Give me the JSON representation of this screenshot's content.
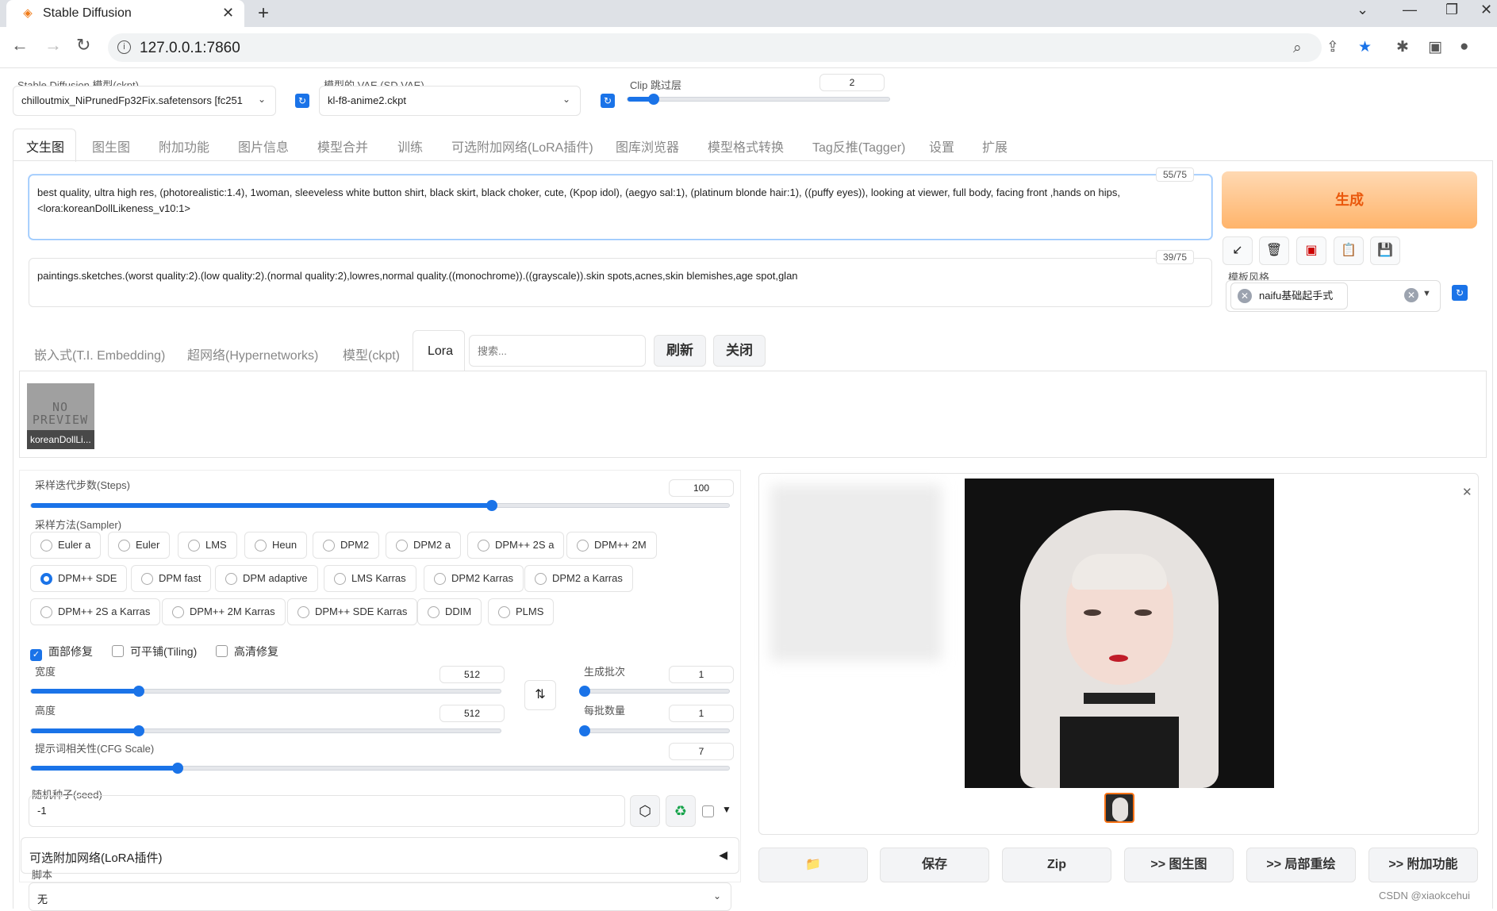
{
  "browser": {
    "tab_title": "Stable Diffusion",
    "url": "127.0.0.1:7860"
  },
  "models": {
    "ckpt_label": "Stable Diffusion 模型(ckpt)",
    "ckpt_value": "chilloutmix_NiPrunedFp32Fix.safetensors [fc251",
    "vae_label": "模型的 VAE (SD VAE)",
    "vae_value": "kl-f8-anime2.ckpt",
    "clip_label": "Clip 跳过层",
    "clip_value": "2",
    "clip_level": 0.1
  },
  "main_tabs": [
    "文生图",
    "图生图",
    "附加功能",
    "图片信息",
    "模型合并",
    "训练",
    "可选附加网络(LoRA插件)",
    "图库浏览器",
    "模型格式转换",
    "Tag反推(Tagger)",
    "设置",
    "扩展"
  ],
  "prompt": {
    "text": "best quality, ultra high res, (photorealistic:1.4), 1woman, sleeveless white button shirt, black skirt, black choker, cute, (Kpop idol), (aegyo sal:1), (platinum blonde hair:1), ((puffy eyes)), looking at viewer, full body, facing front ,hands on hips, <lora:koreanDollLikeness_v10:1>",
    "counter": "55/75"
  },
  "negative": {
    "text": "paintings.sketches.(worst quality:2).(low quality:2).(normal quality:2),lowres,normal quality.((monochrome)).((grayscale)).skin spots,acnes,skin blemishes,age spot,glan",
    "counter": "39/75"
  },
  "generate_label": "生成",
  "action_icons": [
    "arrow-icon",
    "trash-icon",
    "red-card-icon",
    "clipboard-icon",
    "save-icon"
  ],
  "style": {
    "label": "模板风格",
    "chip": "naifu基础起手式"
  },
  "extra_tabs": [
    "嵌入式(T.I. Embedding)",
    "超网络(Hypernetworks)",
    "模型(ckpt)",
    "Lora"
  ],
  "extra_search_placeholder": "搜索...",
  "extra_refresh": "刷新",
  "extra_close": "关闭",
  "lora_card": {
    "preview_text": "NO PREVIEW",
    "name": "koreanDollLi..."
  },
  "steps": {
    "label": "采样迭代步数(Steps)",
    "value": "100",
    "level": 0.66
  },
  "sampler": {
    "label": "采样方法(Sampler)",
    "options": [
      "Euler a",
      "Euler",
      "LMS",
      "Heun",
      "DPM2",
      "DPM2 a",
      "DPM++ 2S a",
      "DPM++ 2M",
      "DPM++ SDE",
      "DPM fast",
      "DPM adaptive",
      "LMS Karras",
      "DPM2 Karras",
      "DPM2 a Karras",
      "DPM++ 2S a Karras",
      "DPM++ 2M Karras",
      "DPM++ SDE Karras",
      "DDIM",
      "PLMS"
    ],
    "selected": "DPM++ SDE"
  },
  "checks": [
    {
      "label": "面部修复",
      "checked": true
    },
    {
      "label": "可平铺(Tiling)",
      "checked": false
    },
    {
      "label": "高清修复",
      "checked": false
    }
  ],
  "width": {
    "label": "宽度",
    "value": "512",
    "level": 0.23
  },
  "height": {
    "label": "高度",
    "value": "512",
    "level": 0.23
  },
  "batch_count": {
    "label": "生成批次",
    "value": "1",
    "level": 0.0
  },
  "batch_size": {
    "label": "每批数量",
    "value": "1",
    "level": 0.0
  },
  "cfg": {
    "label": "提示词相关性(CFG Scale)",
    "value": "7",
    "level": 0.21
  },
  "seed": {
    "label": "随机种子(seed)",
    "value": "-1"
  },
  "lora_plugin_label": "可选附加网络(LoRA插件)",
  "script": {
    "label": "脚本",
    "value": "无"
  },
  "output_buttons": [
    "保存",
    "Zip",
    ">> 图生图",
    ">> 局部重绘",
    ">> 附加功能"
  ],
  "watermark": "CSDN @xiaokcehui"
}
